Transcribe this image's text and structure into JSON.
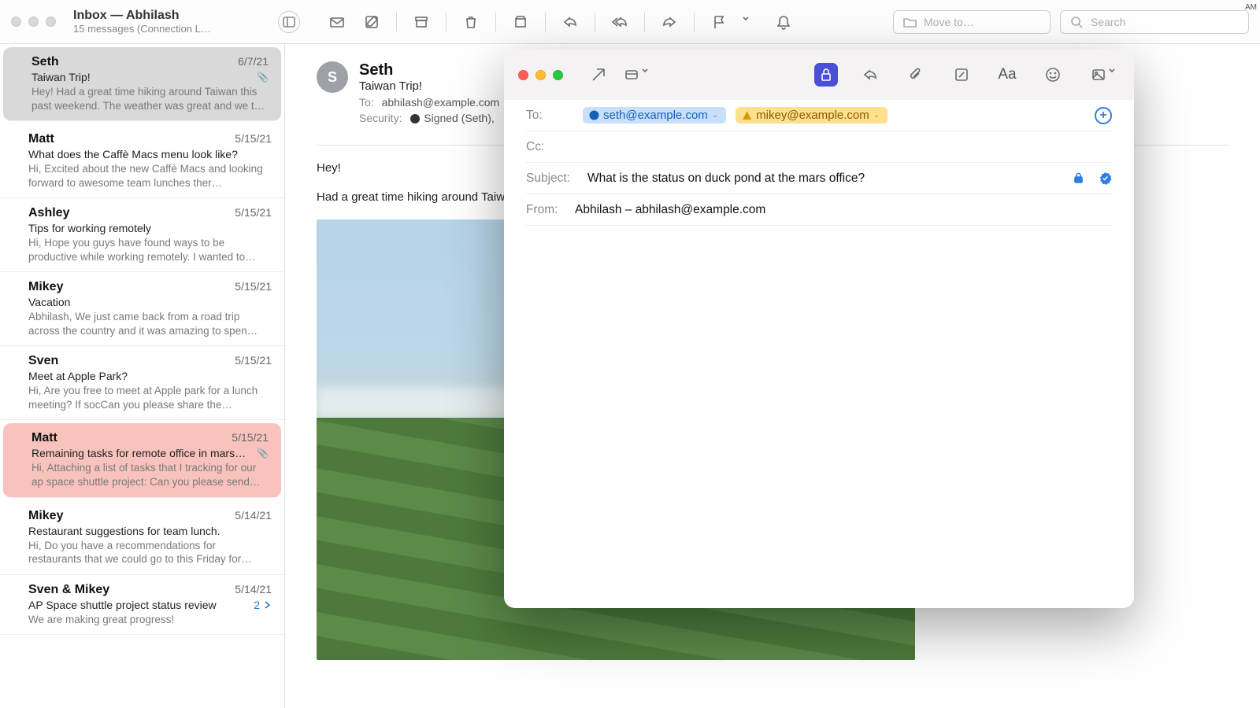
{
  "window": {
    "title": "Inbox — Abhilash",
    "subtitle": "15 messages (Connection L…",
    "am_label": "AM"
  },
  "toolbar": {
    "move_to_placeholder": "Move to…",
    "search_placeholder": "Search"
  },
  "messages": [
    {
      "sender": "Seth",
      "date": "6/7/21",
      "subject": "Taiwan Trip!",
      "preview": "Hey! Had a great time hiking around Taiwan this past weekend. The weather was great and we t…",
      "attachment": true,
      "selected": true
    },
    {
      "sender": "Matt",
      "date": "5/15/21",
      "subject": "What does the Caffè Macs menu look like?",
      "preview": "Hi, Excited about the new Caffè Macs and looking forward to awesome team lunches ther…"
    },
    {
      "sender": "Ashley",
      "date": "5/15/21",
      "subject": "Tips for working remotely",
      "preview": "Hi, Hope you guys have found ways to be productive while working remotely. I wanted to…"
    },
    {
      "sender": "Mikey",
      "date": "5/15/21",
      "subject": "Vacation",
      "preview": "Abhilash, We just came back from a road trip across the country and it was amazing to spen…"
    },
    {
      "sender": "Sven",
      "date": "5/15/21",
      "subject": "Meet at Apple Park?",
      "preview": "Hi, Are you free to meet at Apple park for a lunch meeting? If socCan you please share the…"
    },
    {
      "sender": "Matt",
      "date": "5/15/21",
      "subject": "Remaining tasks for remote office in mars…",
      "preview": "Hi, Attaching a list of tasks that I tracking for our ap space shuttle project: Can you please send…",
      "attachment": true,
      "flagged": true
    },
    {
      "sender": "Mikey",
      "date": "5/14/21",
      "subject": "Restaurant suggestions for team lunch.",
      "preview": "Hi, Do you have a recommendations for restaurants that we could go to this Friday for…"
    },
    {
      "sender": "Sven & Mikey",
      "date": "5/14/21",
      "subject": "AP Space shuttle project status review",
      "preview": "We are making great progress!",
      "thread_count": "2"
    }
  ],
  "reader": {
    "avatar_initial": "S",
    "name": "Seth",
    "subject": "Taiwan Trip!",
    "to_label": "To:",
    "to_value": "abhilash@example.com",
    "security_label": "Security:",
    "security_value": "Signed (Seth),",
    "body_line1": "Hey!",
    "body_line2": "Had a great time hiking around Taiwan"
  },
  "compose": {
    "to_label": "To:",
    "recipients": [
      {
        "address": "seth@example.com",
        "style": "blue",
        "icon": "verified"
      },
      {
        "address": "mikey@example.com",
        "style": "yellow",
        "icon": "warning"
      }
    ],
    "cc_label": "Cc:",
    "subject_label": "Subject:",
    "subject_value": "What is the status on duck pond at the mars office?",
    "from_label": "From:",
    "from_value": "Abhilash – abhilash@example.com"
  }
}
